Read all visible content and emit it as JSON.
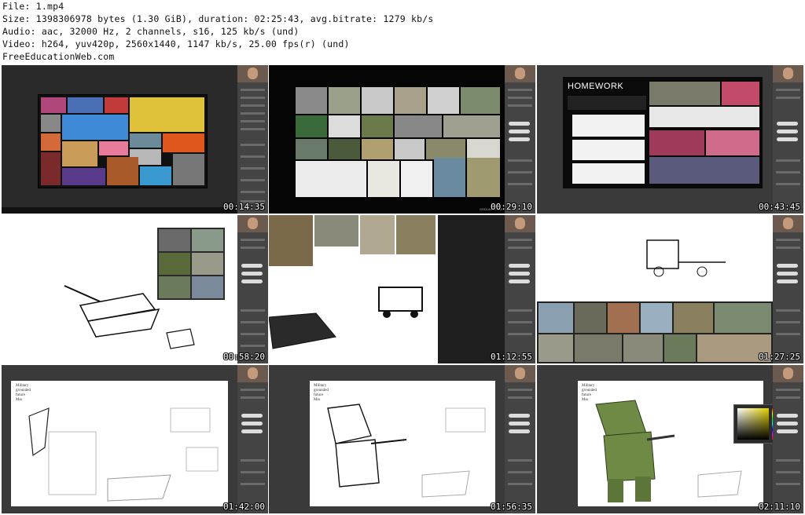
{
  "header": {
    "file_line": "File: 1.mp4",
    "size_line": "Size: 1398306978 bytes (1.30 GiB), duration: 02:25:43, avg.bitrate: 1279 kb/s",
    "audio_line": "Audio: aac, 32000 Hz, 2 channels, s16, 125 kb/s (und)",
    "video_line": "Video: h264, yuv420p, 2560x1440, 1147 kb/s, 25.00 fps(r) (und)",
    "site_line": "FreeEducationWeb.com"
  },
  "thumbnails": [
    {
      "timestamp": "00:14:35"
    },
    {
      "timestamp": "00:29:10",
      "caption": "GROUND COMP M"
    },
    {
      "timestamp": "00:43:45",
      "title": "HOMEWORK"
    },
    {
      "timestamp": "00:58:20"
    },
    {
      "timestamp": "01:12:55"
    },
    {
      "timestamp": "01:27:25"
    },
    {
      "timestamp": "01:42:00"
    },
    {
      "timestamp": "01:56:35"
    },
    {
      "timestamp": "02:11:10"
    }
  ],
  "sketch_note": [
    "Military",
    "grounded",
    "future",
    "Mss"
  ],
  "colors": {
    "ps_dark": "#2a2a2a",
    "panel": "#444444",
    "mech_green": "#6f8a45",
    "timestamp_text": "#ffffff"
  }
}
